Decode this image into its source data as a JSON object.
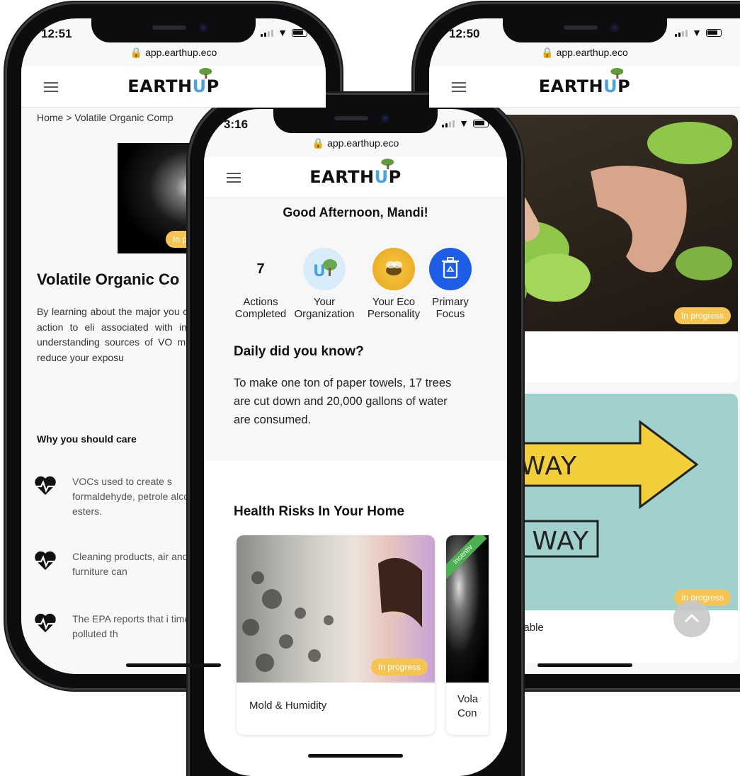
{
  "phones": {
    "left": {
      "time": "12:51",
      "url": "app.earthup.eco",
      "logo": "EARTHUP",
      "breadcrumb": "Home > Volatile Organic Comp",
      "badge": "In pr",
      "title": "Volatile Organic Co",
      "description": "By learning about the major you can take action to eli associated with indoor ai understanding sources of VO massively reduce your exposu",
      "why_heading": "Why you should care",
      "bullets": [
        {
          "icon": "heart-pulse-icon",
          "text": "VOCs used to create s formaldehyde, petrole alcohol and esters."
        },
        {
          "icon": "heart-pulse-icon",
          "text": "Cleaning products, air and even furniture can"
        },
        {
          "icon": "heart-pulse-icon",
          "text": "The EPA reports that i times more polluted th"
        }
      ]
    },
    "right": {
      "time": "12:50",
      "url": "app.earthup.eco",
      "logo": "EARTHUP",
      "card1_badge": "In progress",
      "card2_badge": "In progress",
      "card2_title": "About Sustainable",
      "arrow_new": "NEW WAY",
      "arrow_old": "OLD WAY"
    },
    "center": {
      "time": "3:16",
      "url": "app.earthup.eco",
      "logo": "EARTHUP",
      "greeting": "Good Afternoon, Mandi!",
      "stats": [
        {
          "value": "7",
          "label_line1": "Actions",
          "label_line2": "Completed"
        },
        {
          "label_line1": "Your",
          "label_line2": "Organization",
          "icon": "organization-icon"
        },
        {
          "label_line1": "Your Eco",
          "label_line2": "Personality",
          "icon": "bee-icon"
        },
        {
          "label_line1": "Primary",
          "label_line2": "Focus",
          "icon": "recycle-bin-icon"
        }
      ],
      "dyk_title": "Daily did you know?",
      "dyk_text": "To make one ton of paper towels, 17 trees are cut down and 20,000 gallons of water are consumed.",
      "health_title": "Health Risks In Your Home",
      "cards": [
        {
          "label": "Mold & Humidity",
          "badge": "In progress"
        },
        {
          "label_line1": "Vola",
          "label_line2": "Con",
          "ribbon": "Incentiv"
        }
      ]
    }
  },
  "colors": {
    "brand_blue": "#4aa3df",
    "badge_yellow": "#f5c453",
    "ribbon_green": "#4caf50",
    "focus_blue": "#1e5ee6"
  }
}
